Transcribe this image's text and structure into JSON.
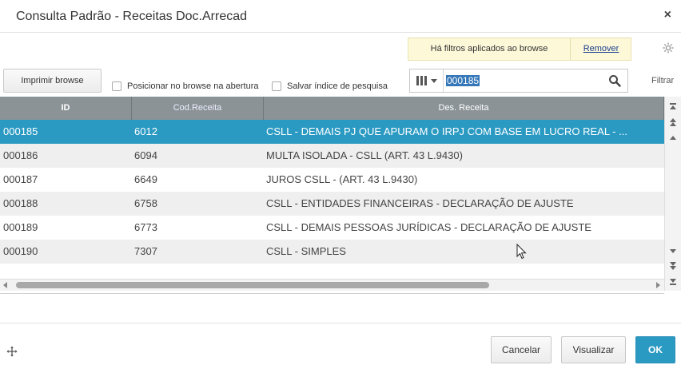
{
  "window": {
    "title": "Consulta Padrão - Receitas Doc.Arrecad",
    "close_glyph": "×"
  },
  "filter_banner": {
    "message": "Há filtros aplicados ao browse",
    "remove_label": "Remover"
  },
  "toolbar": {
    "print_label": "Imprimir browse",
    "position_checkbox_label": "Posicionar no browse na abertura",
    "save_index_checkbox_label": "Salvar índice de pesquisa",
    "search_value": "000185",
    "filter_label": "Filtrar",
    "icons": [
      "settings-gear-icon",
      "column-selector-icon",
      "search-icon"
    ]
  },
  "grid": {
    "columns": [
      "ID",
      "Cod.Receita",
      "Des. Receita"
    ],
    "selected_index": 0,
    "rows": [
      {
        "id": "000185",
        "cod": "6012",
        "des": "CSLL - DEMAIS PJ QUE APURAM O IRPJ COM BASE EM LUCRO REAL - ..."
      },
      {
        "id": "000186",
        "cod": "6094",
        "des": "MULTA ISOLADA - CSLL (ART. 43 L.9430)"
      },
      {
        "id": "000187",
        "cod": "6649",
        "des": "JUROS CSLL - (ART. 43 L.9430)"
      },
      {
        "id": "000188",
        "cod": "6758",
        "des": "CSLL - ENTIDADES FINANCEIRAS - DECLARAÇÃO DE AJUSTE"
      },
      {
        "id": "000189",
        "cod": "6773",
        "des": "CSLL - DEMAIS PESSOAS JURÍDICAS - DECLARAÇÃO DE AJUSTE"
      },
      {
        "id": "000190",
        "cod": "7307",
        "des": "CSLL - SIMPLES"
      }
    ]
  },
  "footer": {
    "cancel_label": "Cancelar",
    "view_label": "Visualizar",
    "ok_label": "OK"
  },
  "colors": {
    "accent": "#2b9ac2",
    "header_bg": "#8b9396",
    "banner_bg": "#fcf8d8",
    "selection_highlight": "#3577b8"
  }
}
